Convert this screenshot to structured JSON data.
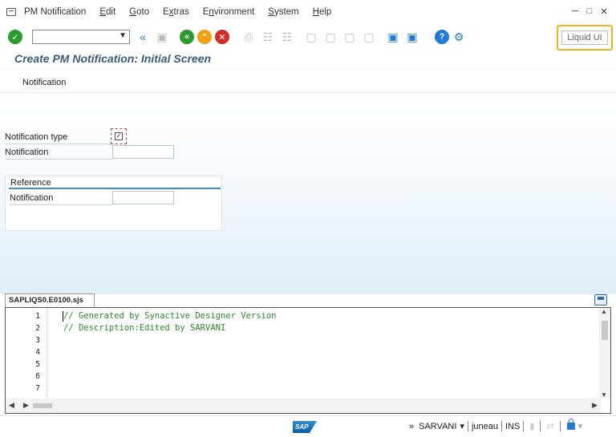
{
  "menubar": {
    "items": [
      {
        "label": "PM Notification",
        "accel": ""
      },
      {
        "label": "Edit",
        "accel": "E"
      },
      {
        "label": "Goto",
        "accel": "G"
      },
      {
        "label": "Extras",
        "accel": "x"
      },
      {
        "label": "Environment",
        "accel": "n"
      },
      {
        "label": "System",
        "accel": "S"
      },
      {
        "label": "Help",
        "accel": "H"
      }
    ],
    "window_controls": [
      "minimize-icon",
      "maximize-icon",
      "close-icon"
    ]
  },
  "toolbar": {
    "command_field": {
      "value": "",
      "placeholder": ""
    },
    "icons": [
      "enter-icon",
      "back-icon",
      "exit-icon",
      "cancel-icon",
      "save-icon",
      "print-icon",
      "find-icon",
      "find-next-icon",
      "first-page-icon",
      "previous-page-icon",
      "next-page-icon",
      "last-page-icon",
      "new-session-icon",
      "shortcut-icon",
      "help-icon",
      "settings-icon"
    ],
    "liquid_ui_label": "Liquid UI"
  },
  "screen": {
    "title": "Create PM Notification: Initial Screen",
    "tab_label": "Notification",
    "fields": {
      "notification_type_label": "Notification type",
      "notification_label": "Notification",
      "notification_value": ""
    },
    "reference_group": {
      "title": "Reference",
      "notification_label": "Notification",
      "notification_value": ""
    }
  },
  "editor": {
    "tab_label": "SAPLIQS0.E0100.sjs",
    "line_numbers": [
      "1",
      "2",
      "3",
      "4",
      "5",
      "6",
      "7"
    ],
    "lines": [
      "// Generated by Synactive Designer Version",
      "// Description:Edited by SARVANI",
      "",
      "",
      "",
      "",
      ""
    ]
  },
  "statusbar": {
    "logo_text": "SAP",
    "chevron": "»",
    "system": "SARVANI",
    "server": "juneau",
    "mode": "INS"
  },
  "colors": {
    "accent_blue": "#1e7bd6",
    "title_color": "#3c5b78",
    "code_green": "#2a8a2a",
    "liquid_ui_border": "#f4b21f"
  }
}
